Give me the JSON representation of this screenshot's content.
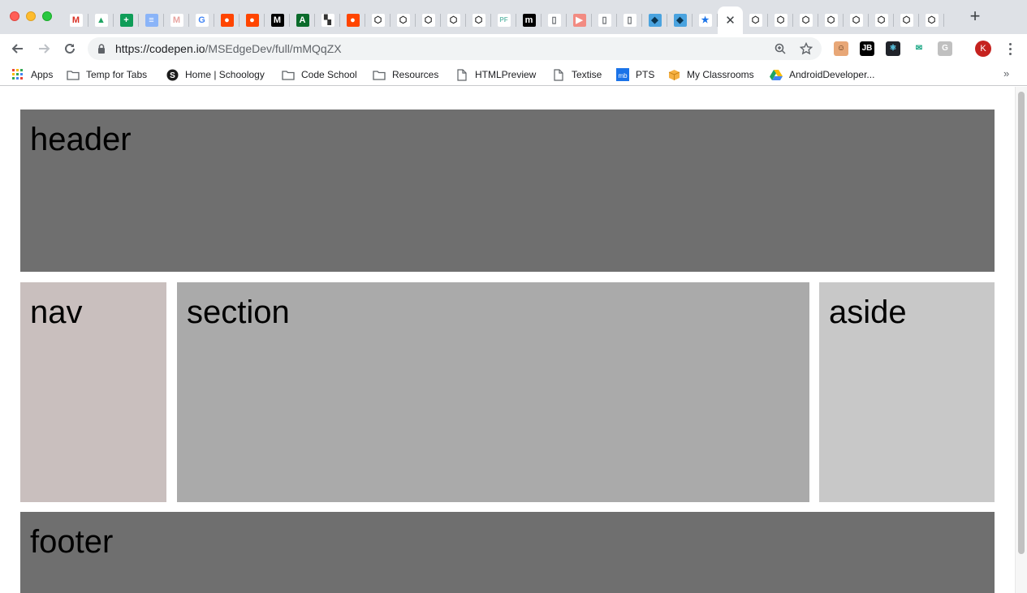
{
  "window": {
    "traffic_lights": [
      "close",
      "minimize",
      "maximize"
    ]
  },
  "tabs": [
    {
      "icon": "gmail-icon",
      "glyph": "M",
      "bg": "#ffffff",
      "fg": "#d93025"
    },
    {
      "icon": "google-drive-icon",
      "glyph": "▲",
      "bg": "#ffffff",
      "fg": "#1fa463"
    },
    {
      "icon": "google-sheets-icon",
      "glyph": "+",
      "bg": "#0f9d58",
      "fg": "#ffffff"
    },
    {
      "icon": "google-docs-icon",
      "glyph": "≡",
      "bg": "#8ab4f8",
      "fg": "#ffffff"
    },
    {
      "icon": "gmail-icon",
      "glyph": "M",
      "bg": "#ffffff",
      "fg": "#e8a3a0"
    },
    {
      "icon": "google-icon",
      "glyph": "G",
      "bg": "#ffffff",
      "fg": "#4285f4"
    },
    {
      "icon": "reddit-icon",
      "glyph": "●",
      "bg": "#ff4500",
      "fg": "#ffffff"
    },
    {
      "icon": "reddit-icon",
      "glyph": "●",
      "bg": "#ff4500",
      "fg": "#ffffff"
    },
    {
      "icon": "medium-icon",
      "glyph": "M",
      "bg": "#000000",
      "fg": "#ffffff"
    },
    {
      "icon": "app-icon",
      "glyph": "A",
      "bg": "#0b6b2b",
      "fg": "#ffffff"
    },
    {
      "icon": "dashboard-icon",
      "glyph": "▚",
      "bg": "#ffffff",
      "fg": "#333333"
    },
    {
      "icon": "reddit-icon",
      "glyph": "●",
      "bg": "#ff4500",
      "fg": "#ffffff"
    },
    {
      "icon": "codepen-icon",
      "glyph": "⬡",
      "bg": "#ffffff",
      "fg": "#222222"
    },
    {
      "icon": "codepen-icon",
      "glyph": "⬡",
      "bg": "#ffffff",
      "fg": "#222222"
    },
    {
      "icon": "codepen-icon",
      "glyph": "⬡",
      "bg": "#ffffff",
      "fg": "#222222"
    },
    {
      "icon": "codepen-icon",
      "glyph": "⬡",
      "bg": "#ffffff",
      "fg": "#222222"
    },
    {
      "icon": "codepen-icon",
      "glyph": "⬡",
      "bg": "#ffffff",
      "fg": "#222222"
    },
    {
      "icon": "pf-icon",
      "glyph": "PF",
      "bg": "#ffffff",
      "fg": "#6fbfb0"
    },
    {
      "icon": "m-icon",
      "glyph": "m",
      "bg": "#000000",
      "fg": "#ffffff"
    },
    {
      "icon": "page-icon",
      "glyph": "▯",
      "bg": "#ffffff",
      "fg": "#5f6368"
    },
    {
      "icon": "youtube-icon",
      "glyph": "▶",
      "bg": "#f28b82",
      "fg": "#ffffff"
    },
    {
      "icon": "page-icon",
      "glyph": "▯",
      "bg": "#ffffff",
      "fg": "#5f6368"
    },
    {
      "icon": "page-icon",
      "glyph": "▯",
      "bg": "#ffffff",
      "fg": "#5f6368"
    },
    {
      "icon": "bird-icon",
      "glyph": "◆",
      "bg": "#4aa3df",
      "fg": "#0b3550"
    },
    {
      "icon": "bird-icon",
      "glyph": "◆",
      "bg": "#4aa3df",
      "fg": "#0b3550"
    },
    {
      "icon": "star-icon",
      "glyph": "★",
      "bg": "#ffffff",
      "fg": "#1a73e8"
    },
    {
      "icon": "close-icon",
      "glyph": "✕",
      "bg": "transparent",
      "fg": "#3c4043",
      "active": true
    },
    {
      "icon": "codepen-icon",
      "glyph": "⬡",
      "bg": "#ffffff",
      "fg": "#222222"
    },
    {
      "icon": "codepen-icon",
      "glyph": "⬡",
      "bg": "#ffffff",
      "fg": "#222222"
    },
    {
      "icon": "codepen-icon",
      "glyph": "⬡",
      "bg": "#ffffff",
      "fg": "#222222"
    },
    {
      "icon": "codepen-icon",
      "glyph": "⬡",
      "bg": "#ffffff",
      "fg": "#222222"
    },
    {
      "icon": "codepen-icon",
      "glyph": "⬡",
      "bg": "#ffffff",
      "fg": "#222222"
    },
    {
      "icon": "codepen-icon",
      "glyph": "⬡",
      "bg": "#ffffff",
      "fg": "#222222"
    },
    {
      "icon": "codepen-icon",
      "glyph": "⬡",
      "bg": "#ffffff",
      "fg": "#222222"
    },
    {
      "icon": "codepen-icon",
      "glyph": "⬡",
      "bg": "#ffffff",
      "fg": "#222222"
    }
  ],
  "new_tab_label": "+",
  "address_bar": {
    "host": "https://codepen.io",
    "path": "/MSEdgeDev/full/mMQqZX"
  },
  "extensions": [
    {
      "icon": "face-extension-icon",
      "glyph": "☺",
      "bg": "#e8a777",
      "fg": "#4a2a10"
    },
    {
      "icon": "jetbrains-extension-icon",
      "glyph": "JB",
      "bg": "#000000",
      "fg": "#ffffff"
    },
    {
      "icon": "react-extension-icon",
      "glyph": "⚛",
      "bg": "#20232a",
      "fg": "#61dafb"
    },
    {
      "icon": "mail-extension-icon",
      "glyph": "✉",
      "bg": "#ffffff",
      "fg": "#10a37f"
    },
    {
      "icon": "grammarly-extension-icon",
      "glyph": "G",
      "bg": "#c0c0c0",
      "fg": "#ffffff"
    }
  ],
  "profile_initial": "K",
  "bookmarks": [
    {
      "label": "Apps",
      "icon": "apps-grid-icon"
    },
    {
      "label": "Temp for Tabs",
      "icon": "folder-icon"
    },
    {
      "label": "Home | Schoology",
      "icon": "schoology-icon"
    },
    {
      "label": "Code School",
      "icon": "folder-icon"
    },
    {
      "label": "Resources",
      "icon": "folder-icon"
    },
    {
      "label": "HTMLPreview",
      "icon": "page-icon"
    },
    {
      "label": "Textise",
      "icon": "page-icon"
    },
    {
      "label": "PTS",
      "icon": "pts-icon"
    },
    {
      "label": "My Classrooms",
      "icon": "box-icon"
    },
    {
      "label": "AndroidDeveloper...",
      "icon": "google-drive-icon"
    }
  ],
  "bookmarks_overflow": "»",
  "layout_demo": {
    "header": "header",
    "nav": "nav",
    "section": "section",
    "aside": "aside",
    "footer": "footer"
  }
}
